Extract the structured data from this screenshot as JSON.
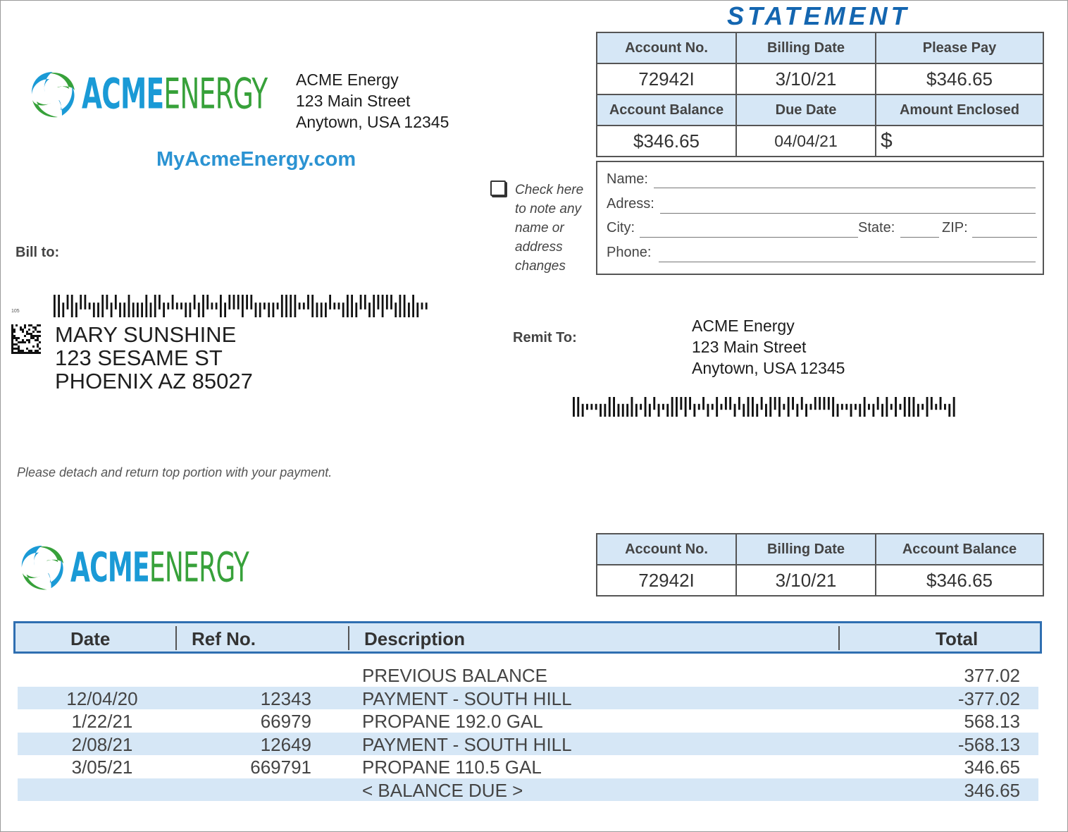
{
  "top_logo": {
    "acme": "ACME",
    "energy": "ENERGY"
  },
  "company_address": {
    "name": "ACME Energy",
    "street": "123 Main Street",
    "city": "Anytown, USA 12345"
  },
  "website": "MyAcmeEnergy.com",
  "statement": {
    "title": "STATEMENT",
    "headers_row1": [
      "Account No.",
      "Billing Date",
      "Please Pay"
    ],
    "values_row1": [
      "72942I",
      "3/10/21",
      "$346.65"
    ],
    "headers_row2": [
      "Account Balance",
      "Due Date",
      "Amount Enclosed"
    ],
    "values_row2": [
      "$346.65",
      "04/04/21",
      "$"
    ]
  },
  "change_note": {
    "line1": "Check here",
    "line2": "to note any",
    "line3": "name or",
    "line4": "address",
    "line5": "changes"
  },
  "change_form": {
    "name": "Name:",
    "address": "Adress:",
    "city": "City:",
    "state": "State:",
    "zip": "ZIP:",
    "phone": "Phone:"
  },
  "bill_to": {
    "label": "Bill to:",
    "small_code": "105",
    "name": "MARY SUNSHINE",
    "street": "123 SESAME ST",
    "city": "PHOENIX AZ 85027"
  },
  "remit_to": {
    "label": "Remit To:",
    "name": "ACME Energy",
    "street": "123 Main Street",
    "city": "Anytown, USA 12345"
  },
  "detach_note": "Please detach and return top portion with your payment.",
  "bottom_logo": {
    "acme": "ACME",
    "energy": "ENERGY"
  },
  "summary": {
    "headers": [
      "Account No.",
      "Billing Date",
      "Account Balance"
    ],
    "values": [
      "72942I",
      "3/10/21",
      "$346.65"
    ]
  },
  "transactions": {
    "columns": [
      "Date",
      "Ref No.",
      "Description",
      "Total"
    ],
    "rows": [
      {
        "date": "",
        "ref": "",
        "desc": "PREVIOUS BALANCE",
        "total": "377.02"
      },
      {
        "date": "12/04/20",
        "ref": "12343",
        "desc": "PAYMENT - SOUTH HILL",
        "total": "-377.02"
      },
      {
        "date": "1/22/21",
        "ref": "66979",
        "desc": "PROPANE 192.0 GAL",
        "total": "568.13"
      },
      {
        "date": "2/08/21",
        "ref": "12649",
        "desc": "PAYMENT - SOUTH HILL",
        "total": "-568.13"
      },
      {
        "date": "3/05/21",
        "ref": "669791",
        "desc": "PROPANE 110.5 GAL",
        "total": "346.65"
      },
      {
        "date": "",
        "ref": "",
        "desc": "< BALANCE DUE >",
        "total": "346.65"
      }
    ]
  },
  "colors": {
    "accent_blue": "#1466b0",
    "logo_blue": "#1a9ad6",
    "logo_green": "#37a13a",
    "header_fill": "#d6e7f6"
  }
}
